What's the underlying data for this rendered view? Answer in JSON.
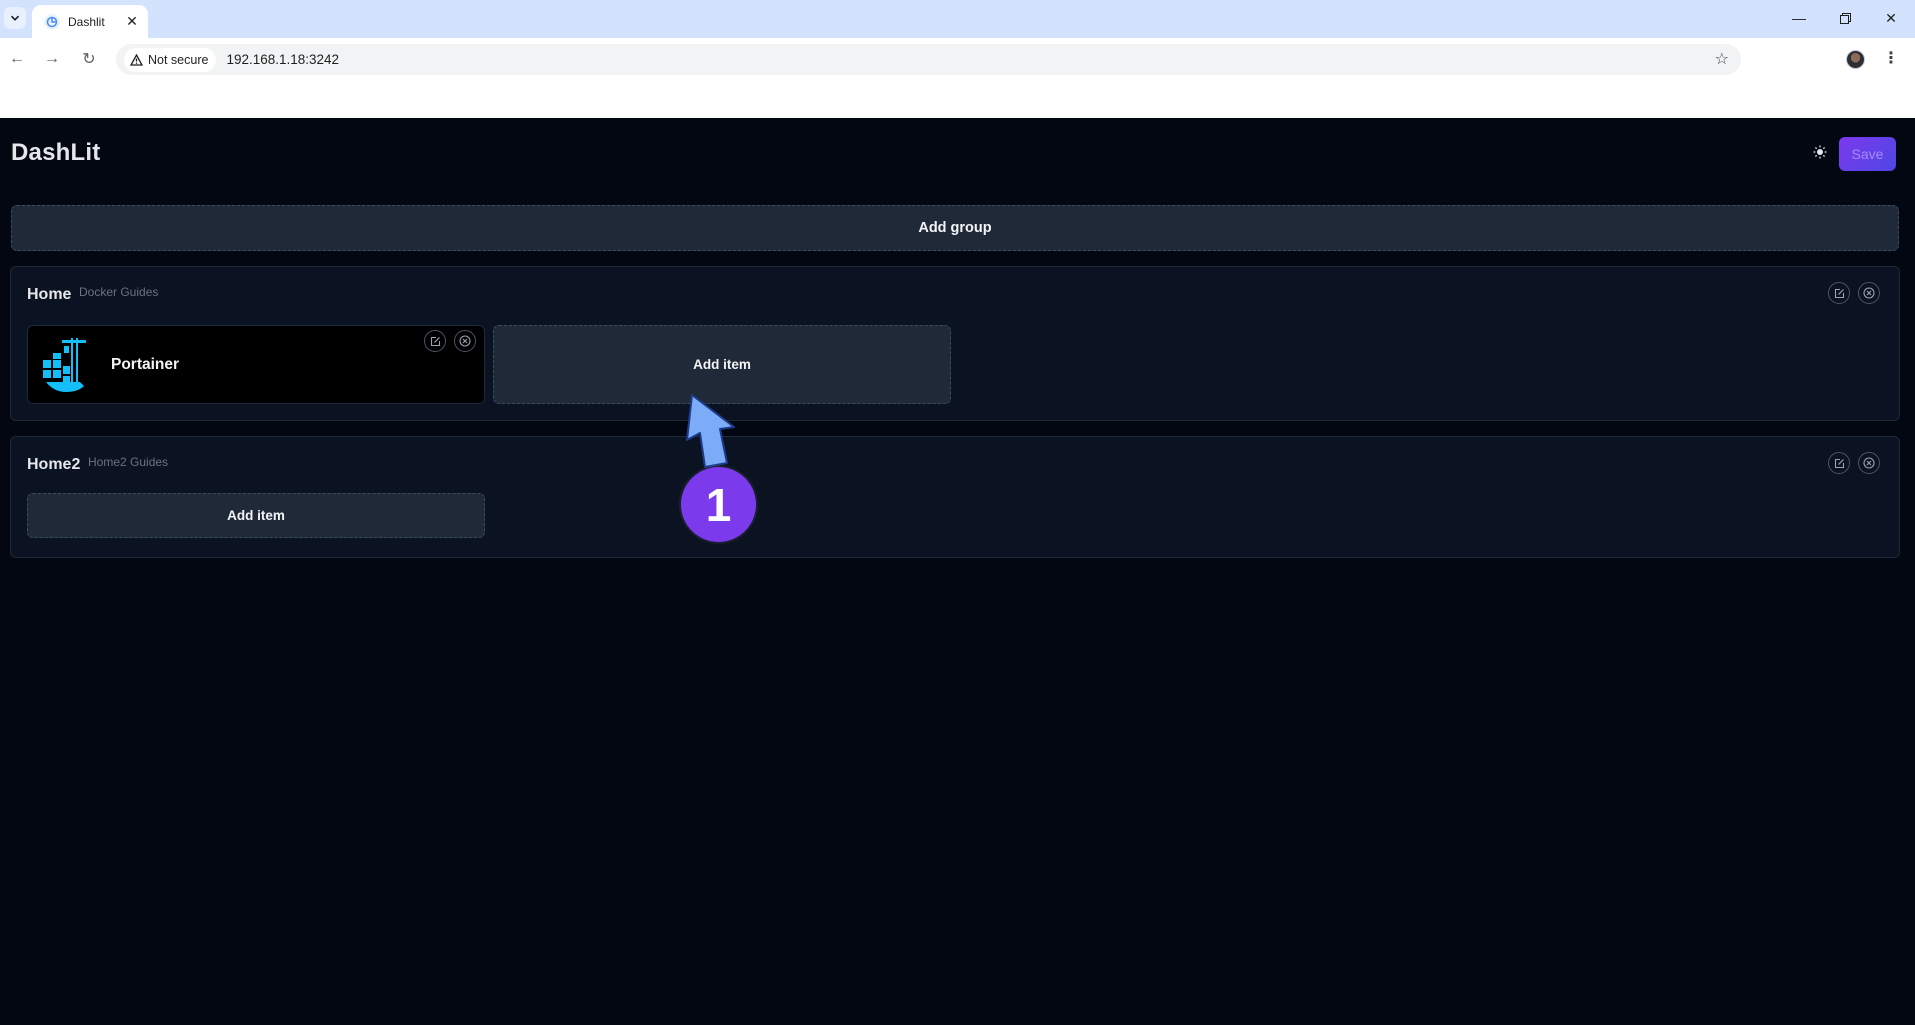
{
  "browser": {
    "tab_title": "Dashlit",
    "security_label": "Not secure",
    "url": "192.168.1.18:3242"
  },
  "app": {
    "title": "DashLit",
    "save_label": "Save",
    "add_group_label": "Add group",
    "accent_color": "#7c3aed"
  },
  "groups": [
    {
      "title": "Home",
      "subtitle": "Docker Guides",
      "items": [
        {
          "name": "Portainer",
          "icon": "portainer-logo-icon"
        }
      ],
      "add_item_label": "Add item"
    },
    {
      "title": "Home2",
      "subtitle": "Home2 Guides",
      "items": [],
      "add_item_label": "Add item"
    }
  ],
  "annotation": {
    "step_number": "1"
  }
}
